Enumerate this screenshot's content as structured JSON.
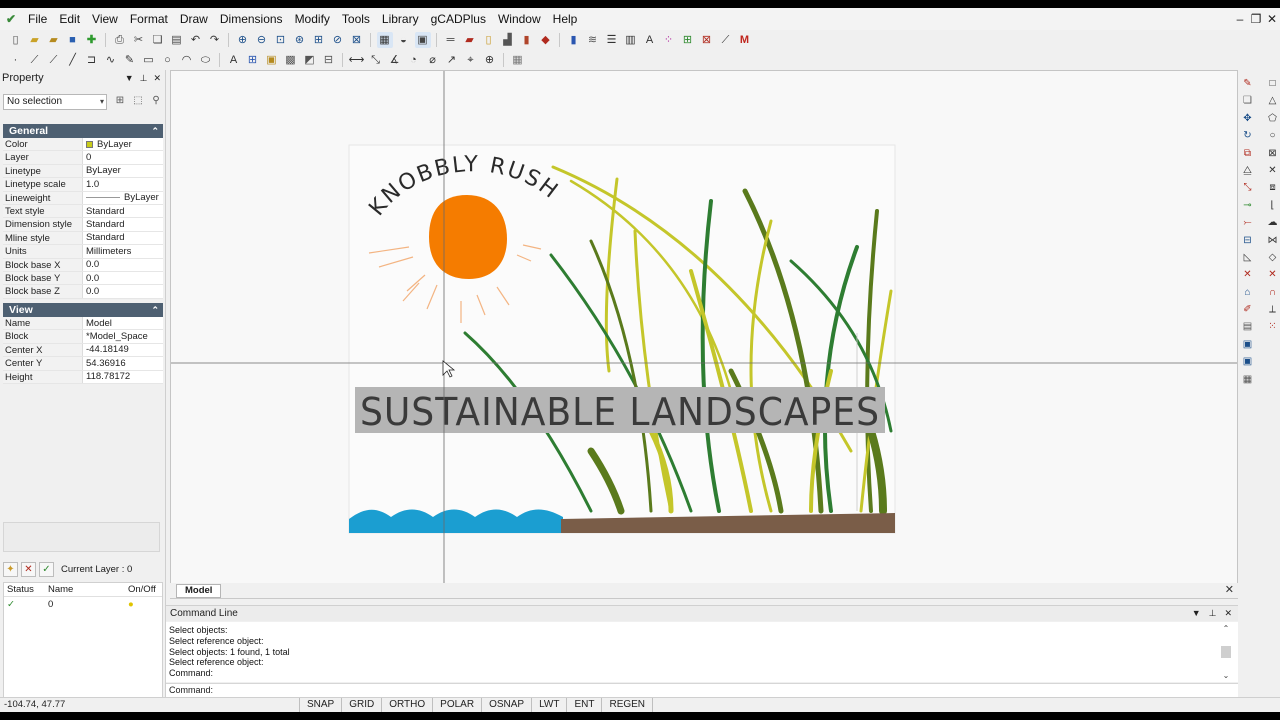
{
  "menubar": {
    "items": [
      "File",
      "Edit",
      "View",
      "Format",
      "Draw",
      "Dimensions",
      "Modify",
      "Tools",
      "Library",
      "gCADPlus",
      "Window",
      "Help"
    ]
  },
  "property_panel": {
    "title": "Property",
    "selection": "No selection",
    "general": {
      "header": "General",
      "rows": [
        {
          "key": "Color",
          "value": "ByLayer"
        },
        {
          "key": "Layer",
          "value": "0"
        },
        {
          "key": "Linetype",
          "value": "ByLayer"
        },
        {
          "key": "Linetype scale",
          "value": "1.0"
        },
        {
          "key": "Lineweight",
          "value": "ByLayer"
        },
        {
          "key": "Text style",
          "value": "Standard"
        },
        {
          "key": "Dimension style",
          "value": "Standard"
        },
        {
          "key": "Mline style",
          "value": "Standard"
        },
        {
          "key": "Units",
          "value": "Millimeters"
        },
        {
          "key": "Block base X",
          "value": "0.0"
        },
        {
          "key": "Block base Y",
          "value": "0.0"
        },
        {
          "key": "Block base Z",
          "value": "0.0"
        }
      ]
    },
    "view": {
      "header": "View",
      "rows": [
        {
          "key": "Name",
          "value": "Model"
        },
        {
          "key": "Block",
          "value": "*Model_Space"
        },
        {
          "key": "Center X",
          "value": "-44.18149"
        },
        {
          "key": "Center Y",
          "value": "54.36916"
        },
        {
          "key": "Height",
          "value": "118.78172"
        }
      ]
    },
    "swatch_color": "#c8cc1a"
  },
  "layers": {
    "current_layer": "Current Layer : 0",
    "columns": [
      "Status",
      "Name",
      "On/Off"
    ],
    "rows": [
      {
        "status": "✓",
        "name": "0",
        "on": "●"
      }
    ]
  },
  "drawing": {
    "arc_text": "KNOBBLY RUSH",
    "banner_text": "SUSTAINABLE LANDSCAPES",
    "colors": {
      "sun": "#f57c00",
      "water": "#1b9ed1",
      "ground": "#7a5d48",
      "grass_dark": "#2e7d32",
      "grass_olive": "#5a7a1c",
      "grass_yellow": "#c4c62a",
      "banner_bg": "#b5b5b5"
    }
  },
  "model_tab": {
    "label": "Model"
  },
  "command": {
    "title": "Command Line",
    "history": [
      "Select objects:",
      "Select reference object:",
      "Select objects: 1 found,  1 total",
      "Select reference object:",
      "Command:"
    ],
    "prompt": "Command:"
  },
  "status": {
    "coords": "-104.74, 47.77",
    "buttons": [
      "SNAP",
      "GRID",
      "ORTHO",
      "POLAR",
      "OSNAP",
      "LWT",
      "ENT",
      "REGEN"
    ]
  }
}
